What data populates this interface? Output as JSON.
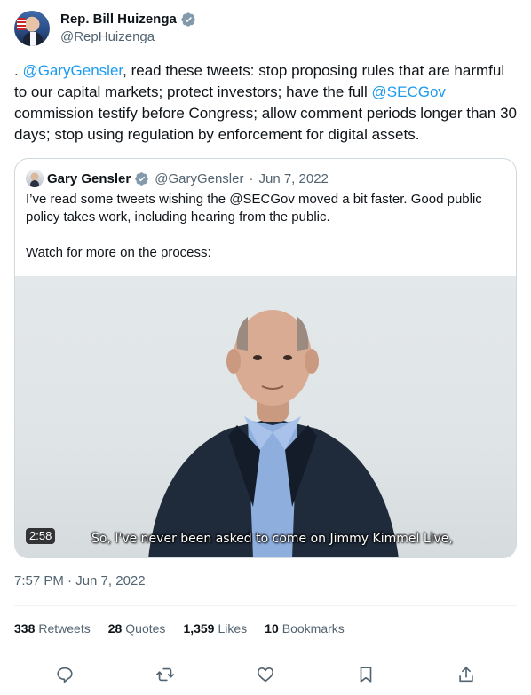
{
  "author": {
    "display_name": "Rep. Bill Huizenga",
    "handle": "@RepHuizenga",
    "avatar_icon": "profile-avatar",
    "verified_icon": "verified-badge-icon"
  },
  "tweet": {
    "prefix": ". ",
    "mention1": "@GaryGensler",
    "part2": ", read these tweets: stop proposing rules that are harmful to our capital markets; protect investors; have the full ",
    "mention2": "@SECGov",
    "part3": " commission testify before Congress; allow comment periods longer than 30 days; stop using regulation by enforcement for digital assets."
  },
  "quote": {
    "display_name": "Gary Gensler",
    "handle": "@GaryGensler",
    "separator": "·",
    "date": "Jun 7, 2022",
    "body": "I’ve read some tweets wishing the @SECGov moved a bit faster. Good public policy takes work, including hearing from the public.\n\nWatch for more on the process:",
    "video": {
      "duration": "2:58",
      "caption": "So, I've never been asked to come on Jimmy Kimmel Live,"
    }
  },
  "timestamp": "7:57 PM · Jun 7, 2022",
  "stats": {
    "retweets_count": "338",
    "retweets_label": "Retweets",
    "quotes_count": "28",
    "quotes_label": "Quotes",
    "likes_count": "1,359",
    "likes_label": "Likes",
    "bookmarks_count": "10",
    "bookmarks_label": "Bookmarks"
  },
  "colors": {
    "accent": "#1d9bf0",
    "text_secondary": "#536471",
    "border": "#cfd9de"
  },
  "action_icons": [
    "reply-icon",
    "retweet-icon",
    "like-icon",
    "bookmark-icon",
    "share-icon"
  ]
}
